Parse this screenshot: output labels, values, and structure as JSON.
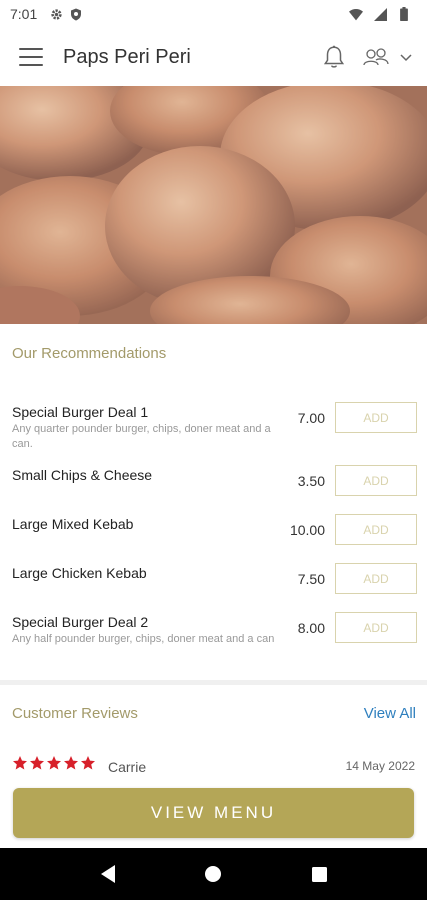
{
  "status_bar": {
    "time": "7:01",
    "icons": [
      "settings-gear-icon",
      "shield-icon",
      "wifi-icon",
      "signal-icon",
      "battery-icon"
    ]
  },
  "app_bar": {
    "title": "Paps Peri Peri",
    "icons": [
      "menu-icon",
      "bell-icon",
      "people-icon",
      "chevron-down-icon"
    ]
  },
  "hero": {
    "image": "grilled peri peri chicken wings"
  },
  "recommendations": {
    "title": "Our Recommendations",
    "items": [
      {
        "name": "Special Burger Deal 1",
        "description": "Any quarter pounder burger, chips, doner meat and a can.",
        "price": "7.00",
        "add_label": "ADD"
      },
      {
        "name": "Small Chips & Cheese",
        "description": "",
        "price": "3.50",
        "add_label": "ADD"
      },
      {
        "name": "Large Mixed Kebab",
        "description": "",
        "price": "10.00",
        "add_label": "ADD"
      },
      {
        "name": "Large Chicken Kebab",
        "description": "",
        "price": "7.50",
        "add_label": "ADD"
      },
      {
        "name": "Special Burger Deal 2",
        "description": "Any half pounder burger, chips, doner meat and a can",
        "price": "8.00",
        "add_label": "ADD"
      }
    ]
  },
  "reviews": {
    "title": "Customer Reviews",
    "view_all": "View All",
    "items": [
      {
        "rating": 5,
        "reviewer": "Carrie",
        "date": "14 May 2022"
      }
    ]
  },
  "view_menu_button": "VIEW MENU",
  "colors": {
    "accent_gold": "#b4a657",
    "section_title": "#a39a6a",
    "add_border": "#d9d3ad",
    "link_blue": "#2e7fbe",
    "star_red": "#d7202a"
  },
  "nav_bar": {
    "icons": [
      "back-icon",
      "home-icon",
      "recents-icon"
    ]
  }
}
